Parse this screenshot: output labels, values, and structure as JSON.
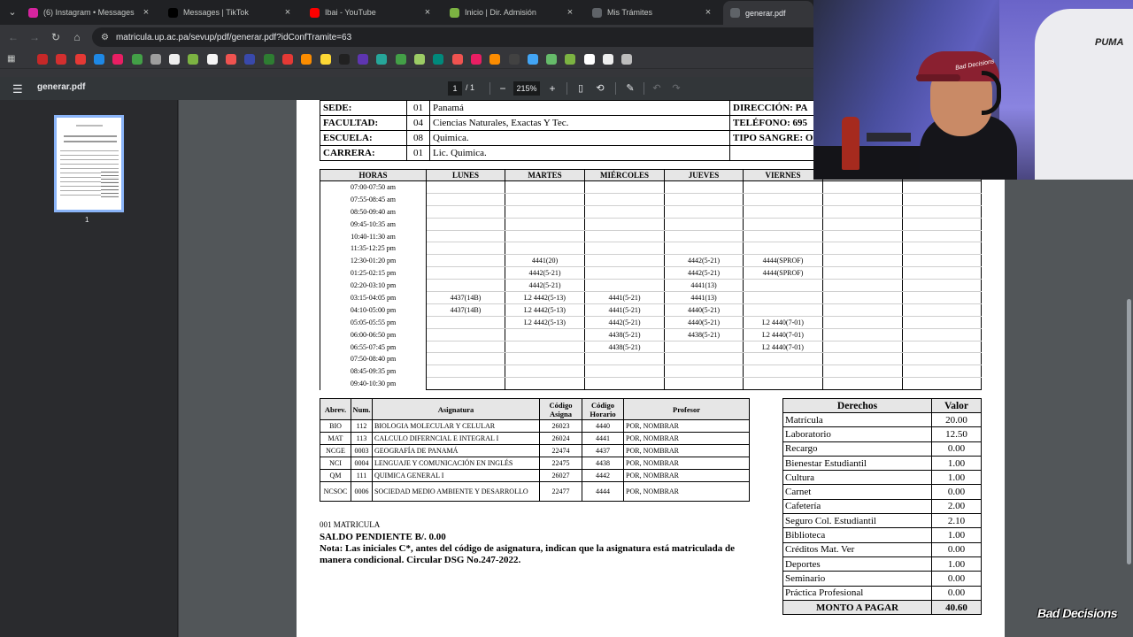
{
  "tabs": [
    {
      "title": "(6) Instagram • Messages",
      "icon": "instagram-icon",
      "color": "#d6249f"
    },
    {
      "title": "Messages | TikTok",
      "icon": "tiktok-icon",
      "color": "#000000"
    },
    {
      "title": "Ibai - YouTube",
      "icon": "youtube-icon",
      "color": "#ff0000"
    },
    {
      "title": "Inicio | Dir. Admisión",
      "icon": "site-icon",
      "color": "#7cb342"
    },
    {
      "title": "Mis Trámites",
      "icon": "globe-icon",
      "color": "#5f6368"
    },
    {
      "title": "generar.pdf",
      "icon": "globe-icon",
      "color": "#5f6368"
    }
  ],
  "address": "matricula.up.ac.pa/sevup/pdf/generar.pdf?idConfTramite=63",
  "pdf": {
    "filename": "generar.pdf",
    "page_current": "1",
    "page_total": "/ 1",
    "zoom": "215%",
    "thumb_label": "1"
  },
  "header_rows": [
    {
      "label": "SEDE:",
      "code": "01",
      "value": "Panamá",
      "label2": "DIRECCIÓN: PA"
    },
    {
      "label": "FACULTAD:",
      "code": "04",
      "value": "Ciencias Naturales, Exactas Y Tec.",
      "label2": "TELÉFONO: 695"
    },
    {
      "label": "ESCUELA:",
      "code": "08",
      "value": "Quimica.",
      "label2": "TIPO SANGRE: O"
    },
    {
      "label": "CARRERA:",
      "code": "01",
      "value": "Lic. Quimica.",
      "label2": ""
    }
  ],
  "schedule": {
    "headers": [
      "HORAS",
      "LUNES",
      "MARTES",
      "MIÉRCOLES",
      "JUEVES",
      "VIERNES",
      "",
      ""
    ],
    "rows": [
      [
        "07:00-07:50 am",
        "",
        "",
        "",
        "",
        "",
        "",
        ""
      ],
      [
        "07:55-08:45 am",
        "",
        "",
        "",
        "",
        "",
        "",
        ""
      ],
      [
        "08:50-09:40 am",
        "",
        "",
        "",
        "",
        "",
        "",
        ""
      ],
      [
        "09:45-10:35 am",
        "",
        "",
        "",
        "",
        "",
        "",
        ""
      ],
      [
        "10:40-11:30 am",
        "",
        "",
        "",
        "",
        "",
        "",
        ""
      ],
      [
        "11:35-12:25 pm",
        "",
        "",
        "",
        "",
        "",
        "",
        ""
      ],
      [
        "12:30-01:20 pm",
        "",
        "4441(20)",
        "",
        "4442(5-21)",
        "4444(SPROF)",
        "",
        ""
      ],
      [
        "01:25-02:15 pm",
        "",
        "4442(5-21)",
        "",
        "4442(5-21)",
        "4444(SPROF)",
        "",
        ""
      ],
      [
        "02:20-03:10 pm",
        "",
        "4442(5-21)",
        "",
        "4441(13)",
        "",
        "",
        ""
      ],
      [
        "03:15-04:05 pm",
        "4437(14B)",
        "L2 4442(5-13)",
        "4441(5-21)",
        "4441(13)",
        "",
        "",
        ""
      ],
      [
        "04:10-05:00 pm",
        "4437(14B)",
        "L2 4442(5-13)",
        "4441(5-21)",
        "4440(5-21)",
        "",
        "",
        ""
      ],
      [
        "05:05-05:55 pm",
        "",
        "L2 4442(5-13)",
        "4442(5-21)",
        "4440(5-21)",
        "L2 4440(7-01)",
        "",
        ""
      ],
      [
        "06:00-06:50 pm",
        "",
        "",
        "4438(5-21)",
        "4438(5-21)",
        "L2 4440(7-01)",
        "",
        ""
      ],
      [
        "06:55-07:45 pm",
        "",
        "",
        "4438(5-21)",
        "",
        "L2 4440(7-01)",
        "",
        ""
      ],
      [
        "07:50-08:40 pm",
        "",
        "",
        "",
        "",
        "",
        "",
        ""
      ],
      [
        "08:45-09:35 pm",
        "",
        "",
        "",
        "",
        "",
        "",
        ""
      ],
      [
        "09:40-10:30 pm",
        "",
        "",
        "",
        "",
        "",
        "",
        ""
      ]
    ]
  },
  "subjects": {
    "headers": [
      "Abrev.",
      "Num.",
      "Asignatura",
      "Código Asigna",
      "Código Horario",
      "Profesor"
    ],
    "rows": [
      [
        "BIO",
        "112",
        "BIOLOGIA MOLECULAR Y CELULAR",
        "26023",
        "4440",
        "POR, NOMBRAR"
      ],
      [
        "MAT",
        "113",
        "CALCULO DIFERNCIAL E INTEGRAL I",
        "26024",
        "4441",
        "POR, NOMBRAR"
      ],
      [
        "NCGE",
        "0003",
        "GEOGRAFÍA DE PANAMÁ",
        "22474",
        "4437",
        "POR, NOMBRAR"
      ],
      [
        "NCI",
        "0004",
        "LENGUAJE Y COMUNICACIÓN EN INGLÉS",
        "22475",
        "4438",
        "POR, NOMBRAR"
      ],
      [
        "QM",
        "111",
        "QUIMICA GENERAL I",
        "26027",
        "4442",
        "POR, NOMBRAR"
      ],
      [
        "NCSOC",
        "0006",
        "SOCIEDAD MEDIO AMBIENTE Y DESARROLLO",
        "22477",
        "4444",
        "POR, NOMBRAR"
      ]
    ]
  },
  "fees": {
    "headers": [
      "Derechos",
      "Valor"
    ],
    "rows": [
      [
        "Matrícula",
        "20.00"
      ],
      [
        "Laboratorio",
        "12.50"
      ],
      [
        "Recargo",
        "0.00"
      ],
      [
        "Bienestar Estudiantil",
        "1.00"
      ],
      [
        "Cultura",
        "1.00"
      ],
      [
        "Carnet",
        "0.00"
      ],
      [
        "Cafetería",
        "2.00"
      ],
      [
        "Seguro Col. Estudiantil",
        "2.10"
      ],
      [
        "Biblioteca",
        "1.00"
      ],
      [
        "Créditos Mat. Ver",
        "0.00"
      ],
      [
        "Deportes",
        "1.00"
      ],
      [
        "Seminario",
        "0.00"
      ],
      [
        "Práctica Profesional",
        "0.00"
      ]
    ],
    "total_label": "MONTO A PAGAR",
    "total_value": "40.60"
  },
  "footnote": {
    "line1": "001 MATRICULA",
    "line2": "SALDO PENDIENTE B/. 0.00",
    "line3": "Nota: Las iniciales C*, antes del código de asignatura, indican que la asignatura está matriculada de manera condicional. Circular DSG No.247-2022."
  },
  "webcam": {
    "brand": "PUMA",
    "cap_text": "Bad Decisions"
  },
  "watermark": "Bad Decisions"
}
